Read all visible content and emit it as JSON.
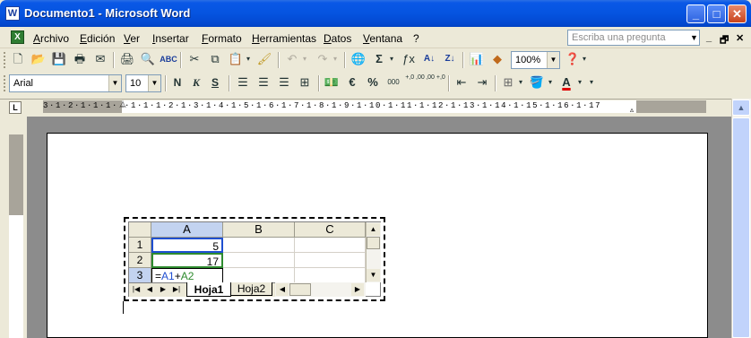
{
  "window": {
    "title": "Documento1 - Microsoft Word",
    "app_icon": "W",
    "controls": {
      "minimize": "_",
      "maximize": "□",
      "close": "✕"
    }
  },
  "menu": {
    "items": [
      "Archivo",
      "Edición",
      "Ver",
      "Insertar",
      "Formato",
      "Herramientas",
      "Datos",
      "Ventana",
      "?"
    ],
    "ask_placeholder": "Escriba una pregunta",
    "mdi_controls": [
      "_",
      "🗗",
      "✕"
    ]
  },
  "toolbar_standard": {
    "zoom": "100%"
  },
  "toolbar_format": {
    "font": "Arial",
    "size": "10",
    "bold": "N",
    "italic": "K",
    "underline": "S",
    "currency": "€",
    "percent": "%",
    "thousands": "000",
    "inc_decimals": "+,0 ,00",
    "dec_decimals": ",00 +,0"
  },
  "ruler": {
    "text": "3·1·2·1·1·1· ·1·1·1·2·1·3·1·4·1·5·1·6·1·7·1·8·1·9·1·10·1·11·1·12·1·13·1·14·1·15·1·16·1·17",
    "corner": "L"
  },
  "spreadsheet": {
    "columns": [
      "A",
      "B",
      "C"
    ],
    "rows": [
      {
        "num": "1",
        "cells": [
          "5",
          "",
          ""
        ]
      },
      {
        "num": "2",
        "cells": [
          "17",
          "",
          ""
        ]
      },
      {
        "num": "3",
        "cells": [
          "=A1+A2",
          "",
          ""
        ]
      }
    ],
    "formula_parts": {
      "eq": "=",
      "ref1": "A1",
      "plus": "+",
      "ref2": "A2"
    },
    "tabs": [
      "Hoja1",
      "Hoja2"
    ],
    "active_tab": "Hoja1"
  },
  "colors": {
    "titlebar": "#0554e0",
    "selected_col_header": "#c3d3f0",
    "ref1": "#1f4fd1",
    "ref2": "#2e8b2e"
  }
}
